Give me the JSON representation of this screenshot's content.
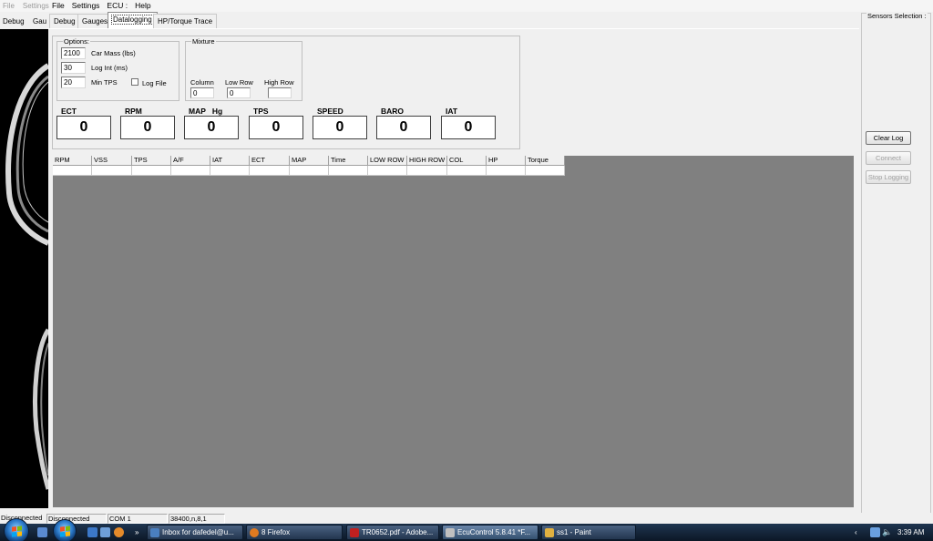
{
  "back_window": {
    "menu": [
      "File",
      "Settings"
    ],
    "tabs": [
      "Debug",
      "Gau"
    ]
  },
  "menu": [
    "File",
    "Settings",
    "ECU :",
    "Help"
  ],
  "tabs": [
    "Debug",
    "Gauges",
    "Datalogging",
    "HP/Torque Trace"
  ],
  "active_tab": "Datalogging",
  "options": {
    "label": "Options:",
    "car_mass": {
      "value": "2100",
      "label": "Car Mass (lbs)"
    },
    "log_int": {
      "value": "30",
      "label": "Log Int (ms)"
    },
    "min_tps": {
      "value": "20",
      "label": "Min TPS"
    },
    "log_file": {
      "label": "Log File",
      "checked": false
    }
  },
  "mixture": {
    "label": "Mixture",
    "column": {
      "label": "Column",
      "value": "0"
    },
    "low_row": {
      "label": "Low Row",
      "value": "0"
    },
    "high_row": {
      "label": "High Row",
      "value": ""
    }
  },
  "gauges": [
    {
      "title": "ECT",
      "value": "0"
    },
    {
      "title": "RPM",
      "value": "0"
    },
    {
      "title": "MAP   Hg",
      "value": "0"
    },
    {
      "title": "TPS",
      "value": "0"
    },
    {
      "title": "SPEED",
      "value": "0"
    },
    {
      "title": "BARO",
      "value": "0"
    },
    {
      "title": "IAT",
      "value": "0"
    }
  ],
  "grid_columns": [
    "RPM",
    "VSS",
    "TPS",
    "A/F",
    "IAT",
    "ECT",
    "MAP",
    "Time",
    "LOW ROW",
    "HIGH ROW",
    "COL",
    "HP",
    "Torque"
  ],
  "sensors": {
    "label": "Sensors Selection :",
    "buttons": [
      {
        "label": "Clear Log",
        "enabled": true
      },
      {
        "label": "Connect",
        "enabled": false
      },
      {
        "label": "Stop Logging",
        "enabled": false
      }
    ]
  },
  "status": {
    "back": "Disconnected",
    "connection": "Disconnected",
    "port": "COM 1",
    "settings": "38400,n,8,1"
  },
  "taskbar": {
    "tasks": [
      {
        "label": "Inbox for dafedel@u...",
        "color": "#4a7fc0"
      },
      {
        "label": "8 Firefox",
        "color": "#e07a20"
      },
      {
        "label": "TR0652.pdf - Adobe...",
        "color": "#c02020"
      },
      {
        "label": "EcuControl 5.8.41 *F...",
        "color": "#c0c0c0"
      },
      {
        "label": "ss1 - Paint",
        "color": "#e0b040"
      }
    ],
    "tray_arrow": "‹",
    "clock": "3:39 AM"
  }
}
